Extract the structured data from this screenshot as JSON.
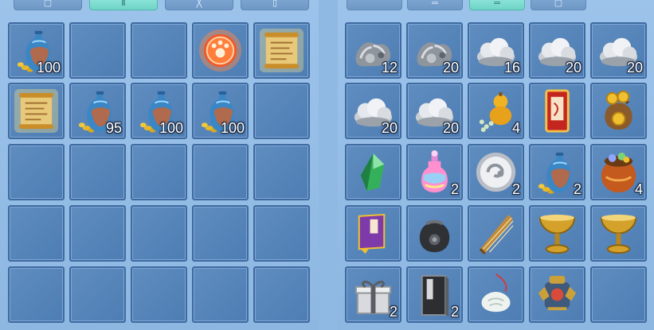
{
  "left_tabs": [
    {
      "label": "▢",
      "active": false
    },
    {
      "label": "Ⅱ",
      "active": true
    },
    {
      "label": "╳",
      "active": false
    },
    {
      "label": "▯",
      "active": false
    }
  ],
  "right_tabs": [
    {
      "label": "",
      "active": false
    },
    {
      "label": "═",
      "active": false
    },
    {
      "label": "═",
      "active": true
    },
    {
      "label": "▢",
      "active": false
    }
  ],
  "left_items": [
    {
      "icon": "vase-with-coins-icon",
      "count": "100"
    },
    {
      "icon": "",
      "count": ""
    },
    {
      "icon": "",
      "count": ""
    },
    {
      "icon": "red-paw-orb-icon",
      "count": ""
    },
    {
      "icon": "golden-scroll-icon",
      "count": ""
    },
    {
      "icon": "golden-scroll-icon",
      "count": ""
    },
    {
      "icon": "vase-with-coins-icon",
      "count": "95"
    },
    {
      "icon": "vase-with-coins-icon",
      "count": "100"
    },
    {
      "icon": "vase-with-coins-icon",
      "count": "100"
    },
    {
      "icon": "",
      "count": ""
    },
    {
      "icon": "",
      "count": ""
    },
    {
      "icon": "",
      "count": ""
    },
    {
      "icon": "",
      "count": ""
    },
    {
      "icon": "",
      "count": ""
    },
    {
      "icon": "",
      "count": ""
    },
    {
      "icon": "",
      "count": ""
    },
    {
      "icon": "",
      "count": ""
    },
    {
      "icon": "",
      "count": ""
    },
    {
      "icon": "",
      "count": ""
    },
    {
      "icon": "",
      "count": ""
    },
    {
      "icon": "",
      "count": ""
    },
    {
      "icon": "",
      "count": ""
    },
    {
      "icon": "",
      "count": ""
    },
    {
      "icon": "",
      "count": ""
    },
    {
      "icon": "",
      "count": ""
    }
  ],
  "right_items": [
    {
      "icon": "silver-ore-icon",
      "count": "12"
    },
    {
      "icon": "silver-ore-icon",
      "count": "20"
    },
    {
      "icon": "silver-cloud-icon",
      "count": "16"
    },
    {
      "icon": "silver-cloud-icon",
      "count": "20"
    },
    {
      "icon": "silver-cloud-icon",
      "count": "20"
    },
    {
      "icon": "silver-cloud-icon",
      "count": "20"
    },
    {
      "icon": "silver-cloud-icon",
      "count": "20"
    },
    {
      "icon": "golden-gourd-icon",
      "count": "4"
    },
    {
      "icon": "red-charm-icon",
      "count": ""
    },
    {
      "icon": "gold-coin-bag-icon",
      "count": ""
    },
    {
      "icon": "green-crystal-icon",
      "count": ""
    },
    {
      "icon": "rainbow-potion-icon",
      "count": "2"
    },
    {
      "icon": "silver-token-icon",
      "count": "2"
    },
    {
      "icon": "vase-with-coins-icon",
      "count": "2"
    },
    {
      "icon": "treasure-sack-icon",
      "count": "4"
    },
    {
      "icon": "purple-book-icon",
      "count": ""
    },
    {
      "icon": "black-pouch-icon",
      "count": ""
    },
    {
      "icon": "guzheng-icon",
      "count": ""
    },
    {
      "icon": "golden-chalice-icon",
      "count": ""
    },
    {
      "icon": "golden-chalice-icon",
      "count": ""
    },
    {
      "icon": "gift-box-icon",
      "count": "2"
    },
    {
      "icon": "black-book-icon",
      "count": "2"
    },
    {
      "icon": "jade-pendant-icon",
      "count": ""
    },
    {
      "icon": "armor-set-icon",
      "count": ""
    },
    {
      "icon": "",
      "count": ""
    }
  ],
  "colors": {
    "background": "#8fb9e3",
    "slot": "#5a88bd",
    "slot_border": "#3e6aa0",
    "active_tab": "#7fdccf"
  }
}
